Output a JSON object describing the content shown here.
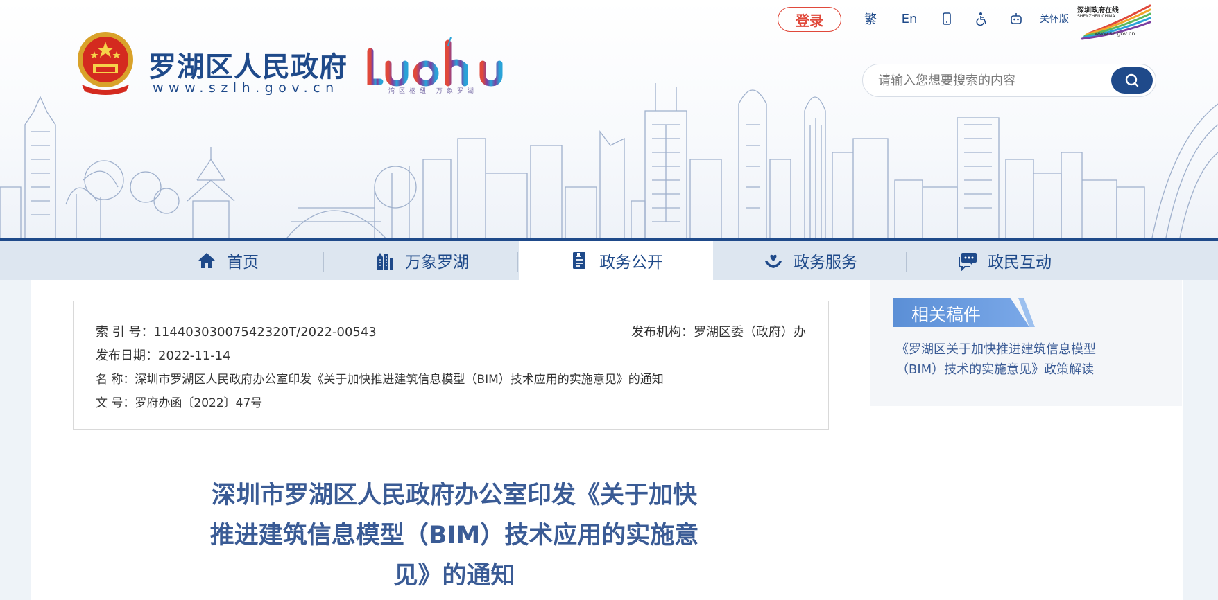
{
  "header": {
    "site_name": "罗湖区人民政府",
    "site_url": "www.szlh.gov.cn",
    "luohu_logo_text": "LUOhU",
    "luohu_slogan": "湾区枢纽  万象罗湖",
    "shenzhen_logo_text": "深圳政府在线",
    "shenzhen_logo_sub": "SHENZHEN CHINA",
    "shenzhen_url": "www.sz.gov.cn"
  },
  "toolbar": {
    "login_label": "登录",
    "traditional_label": "繁",
    "english_label": "En",
    "care_label": "关怀版"
  },
  "search": {
    "placeholder": "请输入您想要搜索的内容"
  },
  "nav": {
    "items": [
      {
        "label": "首页",
        "icon": "home-icon"
      },
      {
        "label": "万象罗湖",
        "icon": "buildings-icon"
      },
      {
        "label": "政务公开",
        "icon": "document-icon"
      },
      {
        "label": "政务服务",
        "icon": "heart-hand-icon"
      },
      {
        "label": "政民互动",
        "icon": "chat-icon"
      }
    ],
    "active_index": 2
  },
  "meta": {
    "index_no": "索 引 号：11440303007542320T/2022-00543",
    "publisher": "发布机构：罗湖区委（政府）办",
    "publish_date": "发布日期：2022-11-14",
    "name": "名 称：深圳市罗湖区人民政府办公室印发《关于加快推进建筑信息模型（BIM）技术应用的实施意见》的通知",
    "doc_no": "文 号：罗府办函〔2022〕47号"
  },
  "article": {
    "title_line1": "深圳市罗湖区人民政府办公室印发《关于加快",
    "title_line2": "推进建筑信息模型（BIM）技术应用的实施意",
    "title_line3": "见》的通知"
  },
  "related": {
    "heading": "相关稿件",
    "link_line1": "《罗湖区关于加快推进建筑信息模型",
    "link_line2": "（BIM）技术的实施意见》政策解读"
  },
  "colors": {
    "brand_blue": "#1f4a8a",
    "login_red": "#e0493b",
    "title_blue": "#3a5b95",
    "tab_blue": "#5b8fd6"
  }
}
